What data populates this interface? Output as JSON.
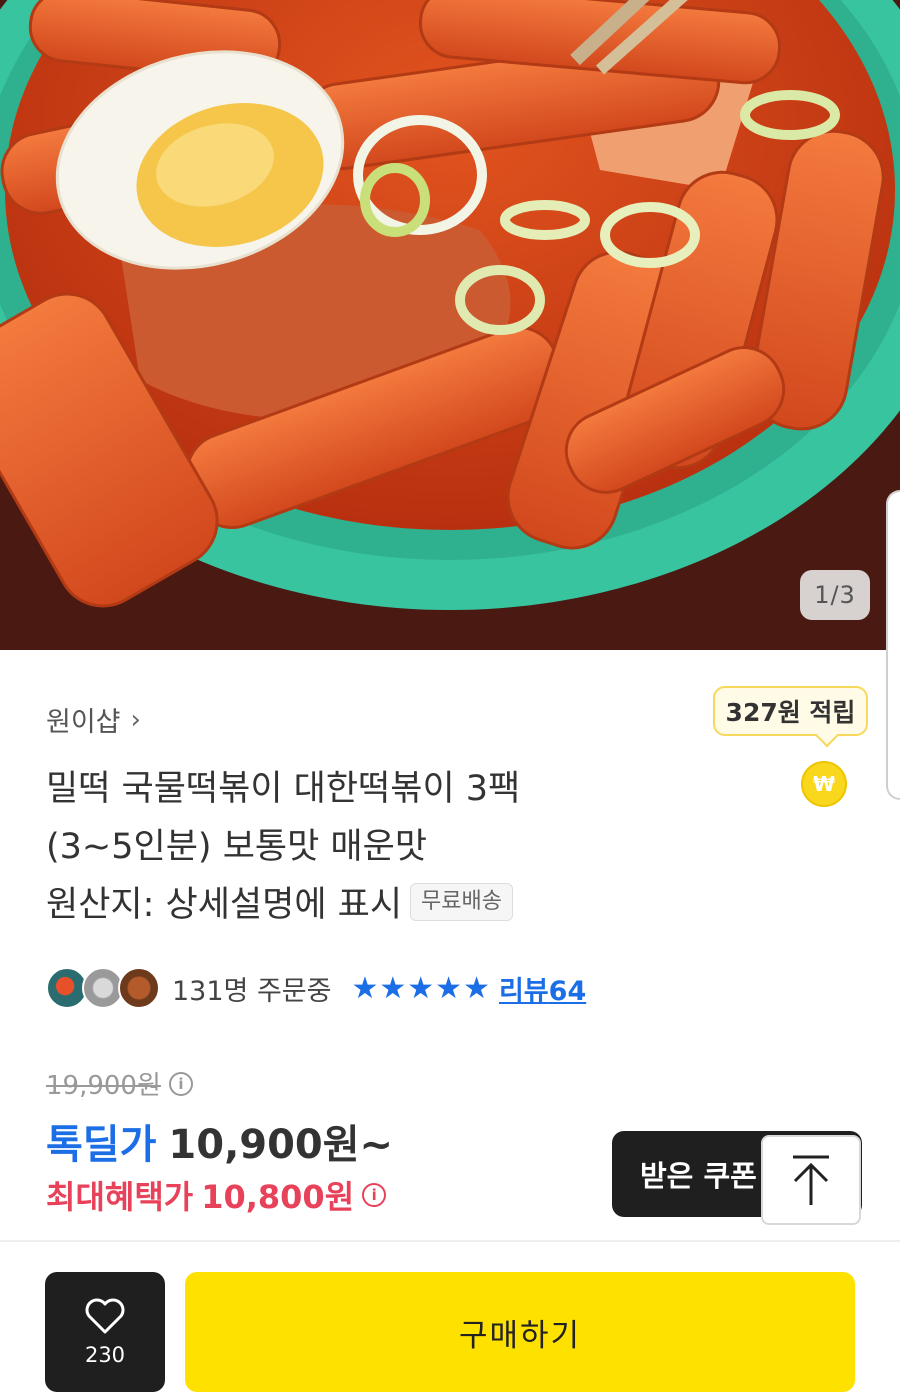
{
  "gallery": {
    "page_indicator": "1/3"
  },
  "seller": {
    "name": "원이샵",
    "chevron": "›"
  },
  "points": {
    "badge": "327원 적립",
    "coin_symbol": "₩"
  },
  "product": {
    "title_lines": [
      "밀떡 국물떡볶이 대한떡볶이 3팩",
      "(3~5인분) 보통맛 매운맛",
      "원산지: 상세설명에 표시"
    ],
    "free_shipping": "무료배송"
  },
  "social": {
    "orders": "131명 주문중",
    "stars": "★★★★★",
    "review_label": "리뷰",
    "review_count": "64"
  },
  "price": {
    "original": "19,900원",
    "deal_label": "톡딜가",
    "deal_price": "10,900원~",
    "max_benefit_label": "최대혜택가",
    "max_benefit_price": "10,800원"
  },
  "coupon": {
    "label": "받은 쿠폰"
  },
  "bottom_bar": {
    "like_count": "230",
    "buy_label": "구매하기"
  },
  "colors": {
    "accent_blue": "#1b6ee6",
    "accent_red": "#e8425a",
    "buy_yellow": "#ffe100"
  }
}
